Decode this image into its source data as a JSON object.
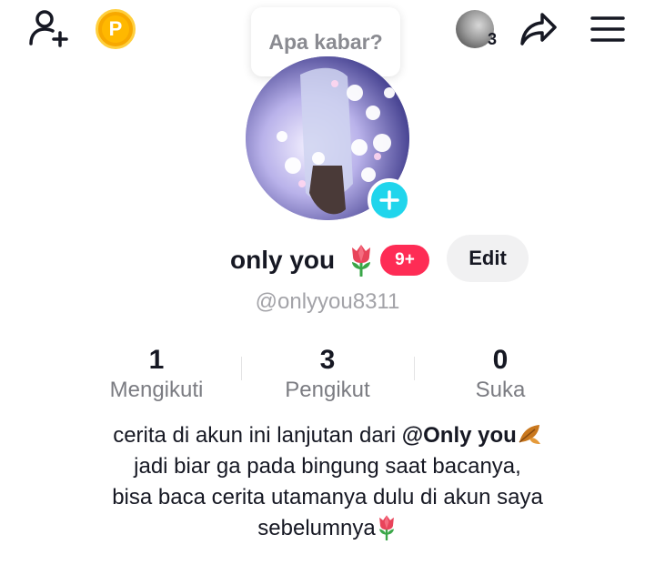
{
  "top_bar": {
    "points_letter": "P",
    "visitor_count": "3",
    "icons": [
      "add-user-icon",
      "points-coin-icon",
      "visitor-avatar",
      "share-icon",
      "menu-icon"
    ]
  },
  "bubble": {
    "text": "Apa kabar?"
  },
  "profile": {
    "name": "only you",
    "name_emoji": "tulip",
    "notification_badge": "9+",
    "edit_label": "Edit",
    "handle": "@onlyyou8311"
  },
  "stats": [
    {
      "value": "1",
      "label": "Mengikuti"
    },
    {
      "value": "3",
      "label": "Pengikut"
    },
    {
      "value": "0",
      "label": "Suka"
    }
  ],
  "bio": {
    "line1_prefix": "cerita di akun ini lanjutan dari ",
    "line1_mention": "@Only you",
    "line2": "jadi biar ga pada bingung saat bacanya,",
    "line3": "bisa baca cerita utamanya dulu di akun saya",
    "line4": "sebelumnya"
  },
  "colors": {
    "accent_pink": "#fe2c55",
    "add_badge_cyan": "#20d5ec",
    "coin_gold": "#ffb800",
    "text_primary": "#161823",
    "text_secondary": "#7b7c82"
  }
}
